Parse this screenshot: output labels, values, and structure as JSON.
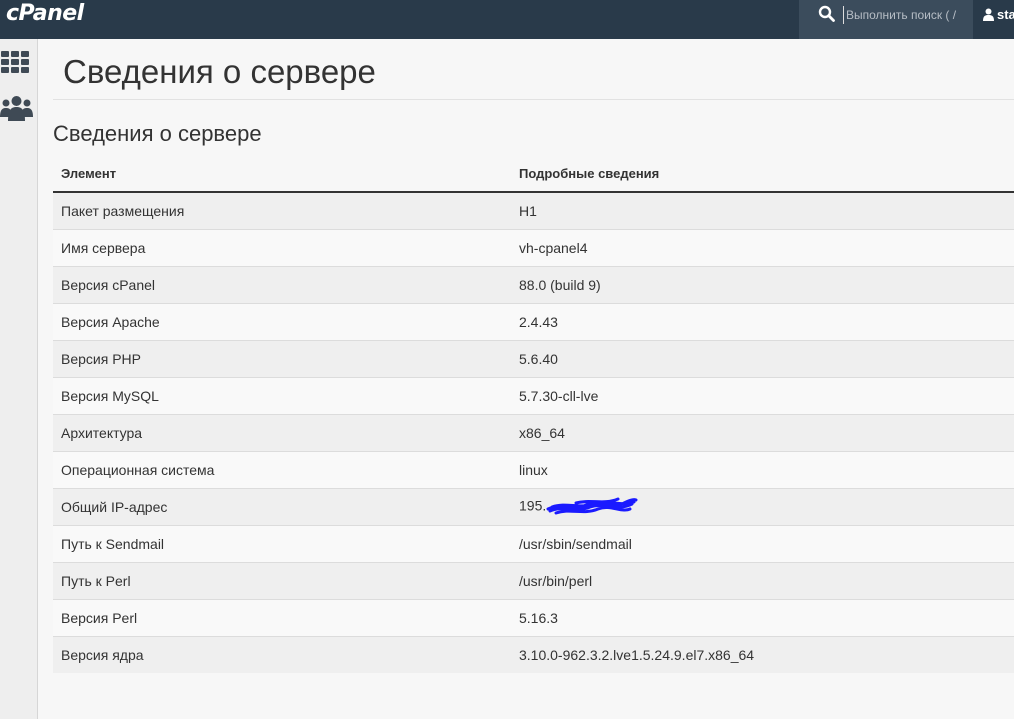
{
  "header": {
    "logo": "cPanel",
    "search_placeholder": "Выполнить поиск ( /",
    "user": "sta"
  },
  "page": {
    "title": "Сведения о сервере",
    "section_title": "Сведения о сервере"
  },
  "table": {
    "columns": [
      "Элемент",
      "Подробные сведения"
    ],
    "rows": [
      {
        "item": "Пакет размещения",
        "value": "H1"
      },
      {
        "item": "Имя сервера",
        "value": "vh-cpanel4"
      },
      {
        "item": "Версия cPanel",
        "value": "88.0 (build 9)"
      },
      {
        "item": "Версия Apache",
        "value": "2.4.43"
      },
      {
        "item": "Версия PHP",
        "value": "5.6.40"
      },
      {
        "item": "Версия MySQL",
        "value": "5.7.30-cll-lve"
      },
      {
        "item": "Архитектура",
        "value": "x86_64"
      },
      {
        "item": "Операционная система",
        "value": "linux"
      },
      {
        "item": "Общий IP-адрес",
        "value": "195."
      },
      {
        "item": "Путь к Sendmail",
        "value": "/usr/sbin/sendmail"
      },
      {
        "item": "Путь к Perl",
        "value": "/usr/bin/perl"
      },
      {
        "item": "Версия Perl",
        "value": "5.16.3"
      },
      {
        "item": "Версия ядра",
        "value": "3.10.0-962.3.2.lve1.5.24.9.el7.x86_64"
      }
    ]
  },
  "icons": {
    "sidebar": [
      "apps-grid-icon",
      "users-icon"
    ],
    "search": "search-icon",
    "user": "user-icon"
  },
  "colors": {
    "topbar": "#293a4a",
    "redaction": "#1a1aff"
  }
}
